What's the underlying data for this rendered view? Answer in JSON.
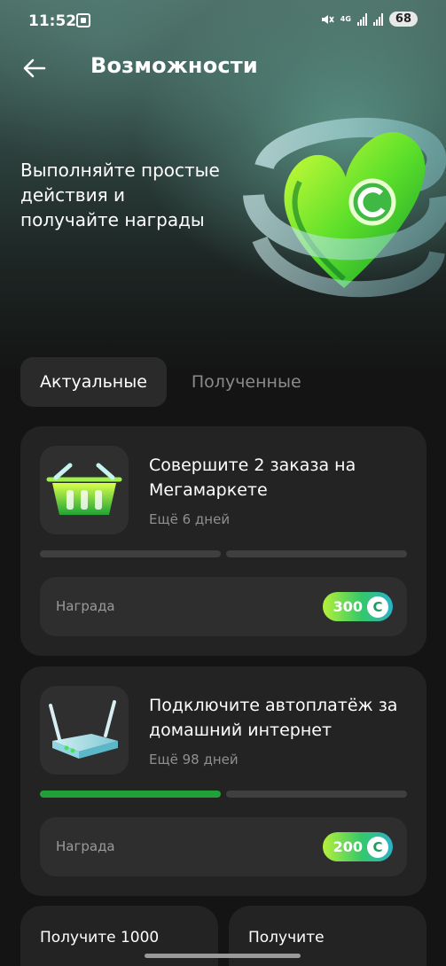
{
  "status_bar": {
    "time": "11:52",
    "network": "4G",
    "battery": "68"
  },
  "header": {
    "title": "Возможности",
    "back_icon": "arrow-left-icon"
  },
  "hero": {
    "text": "Выполняйте простые действия и получайте награды",
    "art": "green-heart-spasibo-illustration"
  },
  "tabs": [
    {
      "label": "Актуальные",
      "active": true
    },
    {
      "label": "Полученные",
      "active": false
    }
  ],
  "tasks": [
    {
      "title": "Совершите 2 заказа на Мегамаркете",
      "deadline": "Ещё 6 дней",
      "icon": "shopping-basket-icon",
      "progress_steps_total": 2,
      "progress_steps_done": 0,
      "reward_label": "Награда",
      "reward_amount": "300"
    },
    {
      "title": "Подключите автоплатёж за домашний интернет",
      "deadline": "Ещё 98 дней",
      "icon": "wifi-router-icon",
      "progress_steps_total": 2,
      "progress_steps_done": 1,
      "reward_label": "Награда",
      "reward_amount": "200"
    }
  ],
  "more_tasks": [
    {
      "title": "Получите 1000"
    },
    {
      "title": "Получите"
    }
  ],
  "colors": {
    "background": "#141414",
    "card": "#232323",
    "accent_green": "#21a038",
    "reward_gradient_start": "#b6f03a",
    "reward_gradient_end": "#2ab2c8"
  }
}
